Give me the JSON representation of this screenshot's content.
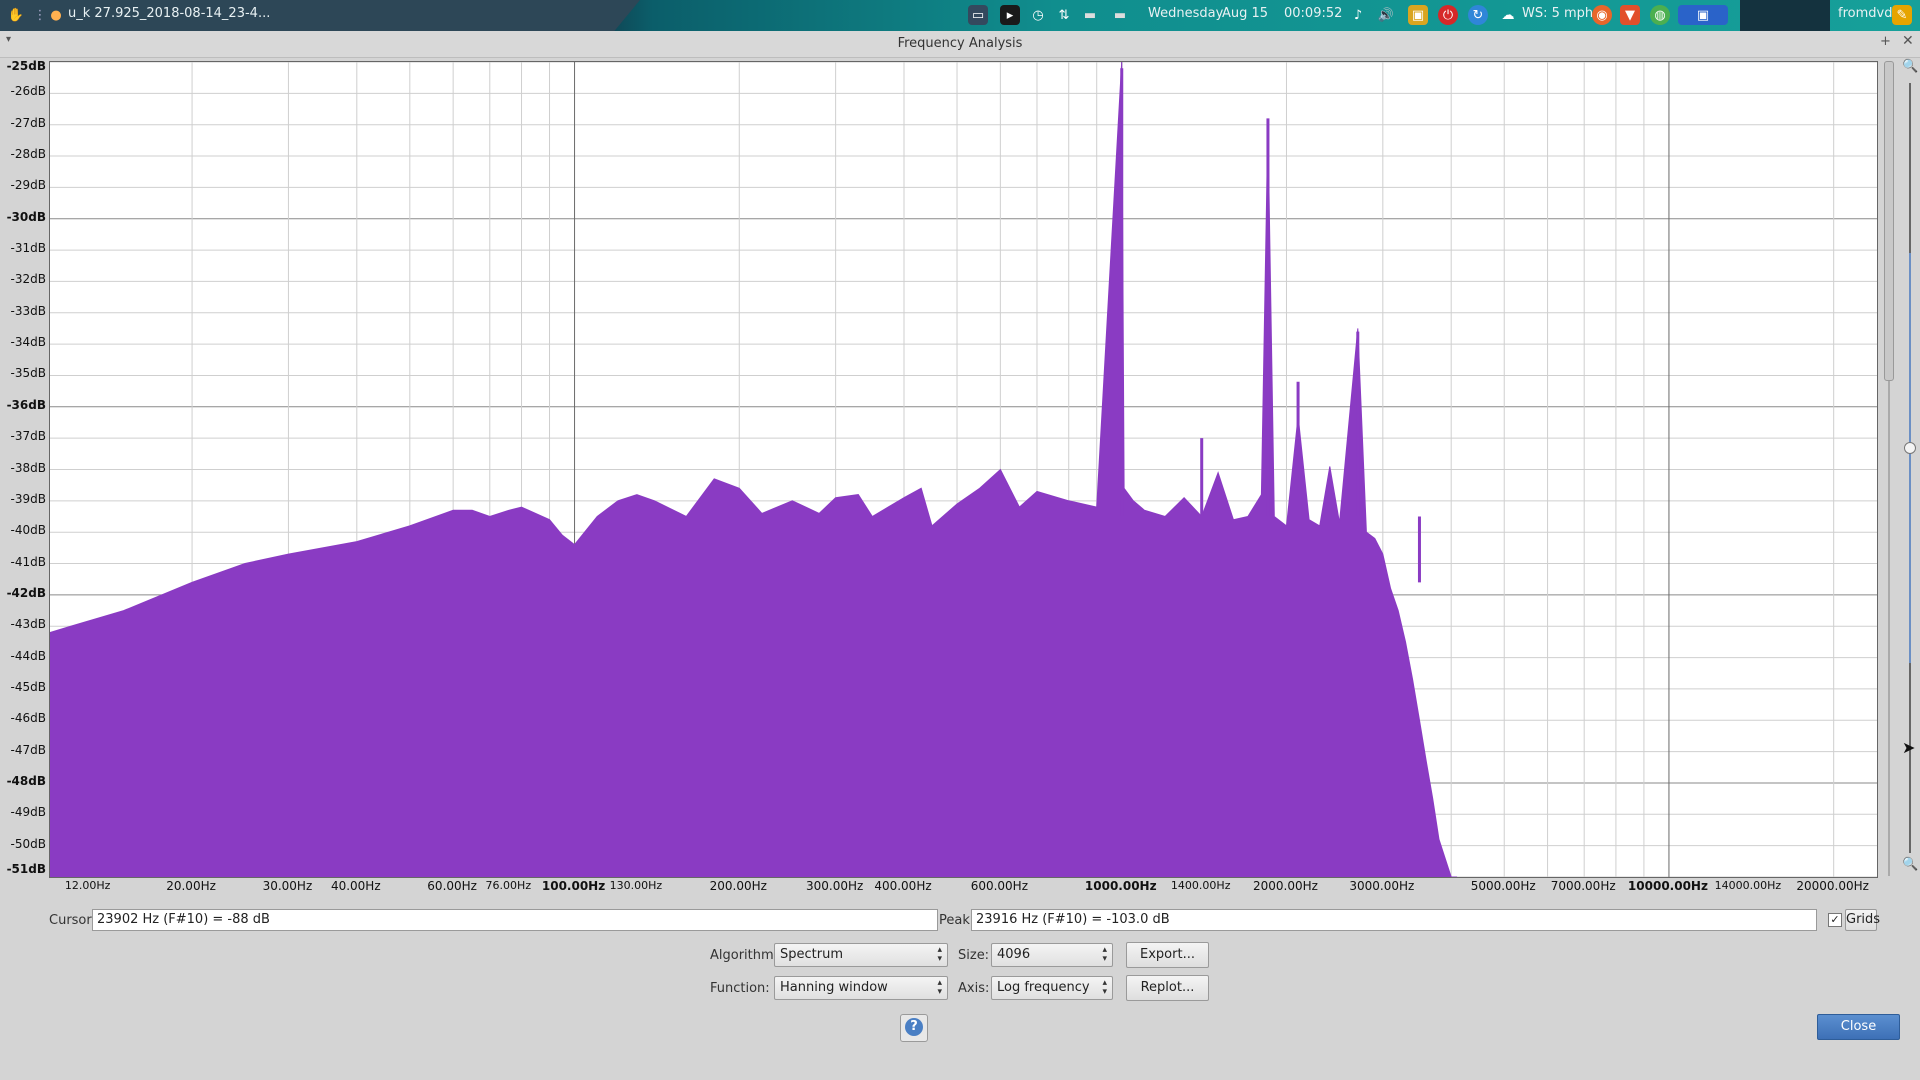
{
  "taskbar": {
    "window_title": "u_k 27.925_2018-08-14_23-4...",
    "day": "Wednesday",
    "date": "Aug 15",
    "time": "00:09:52",
    "weather": "WS: 5 mph",
    "user": "fromdvd"
  },
  "window": {
    "title": "Frequency Analysis"
  },
  "chart_data": {
    "type": "area",
    "title": "",
    "xscale": "log",
    "xlim": [
      11,
      24000
    ],
    "ylim": [
      -51,
      -25
    ],
    "fill_color": "#8a3bc3",
    "grid": true,
    "y_tick_labels": [
      "-25dB",
      "-26dB",
      "-27dB",
      "-28dB",
      "-29dB",
      "-30dB",
      "-31dB",
      "-32dB",
      "-33dB",
      "-34dB",
      "-35dB",
      "-36dB",
      "-37dB",
      "-38dB",
      "-39dB",
      "-40dB",
      "-41dB",
      "-42dB",
      "-43dB",
      "-44dB",
      "-45dB",
      "-46dB",
      "-47dB",
      "-48dB",
      "-49dB",
      "-50dB",
      "-51dB"
    ],
    "x_tick_labels": [
      {
        "f": 12,
        "label": "12.00Hz",
        "size": "small"
      },
      {
        "f": 20,
        "label": "20.00Hz"
      },
      {
        "f": 30,
        "label": "30.00Hz"
      },
      {
        "f": 40,
        "label": "40.00Hz"
      },
      {
        "f": 60,
        "label": "60.00Hz"
      },
      {
        "f": 76,
        "label": "76.00Hz",
        "size": "small"
      },
      {
        "f": 100,
        "label": "100.00Hz",
        "bold": true
      },
      {
        "f": 130,
        "label": "130.00Hz",
        "size": "small"
      },
      {
        "f": 200,
        "label": "200.00Hz"
      },
      {
        "f": 300,
        "label": "300.00Hz"
      },
      {
        "f": 400,
        "label": "400.00Hz"
      },
      {
        "f": 600,
        "label": "600.00Hz"
      },
      {
        "f": 1000,
        "label": "1000.00Hz",
        "bold": true
      },
      {
        "f": 1400,
        "label": "1400.00Hz",
        "size": "small"
      },
      {
        "f": 2000,
        "label": "2000.00Hz"
      },
      {
        "f": 3000,
        "label": "3000.00Hz"
      },
      {
        "f": 5000,
        "label": "5000.00Hz"
      },
      {
        "f": 7000,
        "label": "7000.00Hz"
      },
      {
        "f": 10000,
        "label": "10000.00Hz",
        "bold": true
      },
      {
        "f": 14000,
        "label": "14000.00Hz",
        "size": "small"
      },
      {
        "f": 20000,
        "label": "20000.00Hz"
      }
    ],
    "series": [
      {
        "x": [
          11,
          12,
          15,
          20,
          25,
          30,
          40,
          50,
          60,
          65,
          70,
          76,
          80,
          90,
          95,
          100,
          110,
          120,
          130,
          140,
          160,
          180,
          200,
          220,
          250,
          280,
          300,
          330,
          350,
          400,
          430,
          450,
          500,
          550,
          600,
          650,
          700,
          800,
          900,
          1000,
          1010,
          1050,
          1100,
          1200,
          1300,
          1400,
          1500,
          1600,
          1700,
          1800,
          1850,
          1900,
          2000,
          2100,
          2200,
          2300,
          2400,
          2500,
          2700,
          2800,
          2900,
          3000,
          3100,
          3200,
          3300,
          3400,
          3500,
          3600,
          3700,
          3800,
          4000,
          4100
        ],
        "y": [
          -43.2,
          -43.0,
          -42.5,
          -41.6,
          -41.0,
          -40.7,
          -40.3,
          -39.8,
          -39.3,
          -39.3,
          -39.5,
          -39.3,
          -39.2,
          -39.6,
          -40.1,
          -40.4,
          -39.5,
          -39.0,
          -38.8,
          -39.0,
          -39.5,
          -38.3,
          -38.6,
          -39.4,
          -39.0,
          -39.4,
          -38.9,
          -38.8,
          -39.5,
          -38.9,
          -38.6,
          -39.8,
          -39.1,
          -38.6,
          -38.0,
          -39.2,
          -38.7,
          -39.0,
          -39.2,
          -25.0,
          -38.6,
          -39.0,
          -39.3,
          -39.5,
          -38.9,
          -39.5,
          -38.1,
          -39.6,
          -39.5,
          -38.8,
          -27.0,
          -39.5,
          -39.8,
          -36.3,
          -39.6,
          -39.8,
          -37.9,
          -39.7,
          -33.5,
          -40.0,
          -40.2,
          -40.7,
          -41.8,
          -42.5,
          -43.5,
          -44.7,
          -46.0,
          -47.3,
          -48.5,
          -49.8,
          -51.0,
          -51.0
        ],
        "spikes": [
          {
            "f": 1000,
            "db": -25.2
          },
          {
            "f": 1400,
            "db": -37.0
          },
          {
            "f": 1850,
            "db": -26.8
          },
          {
            "f": 2100,
            "db": -35.2
          },
          {
            "f": 2700,
            "db": -33.6
          },
          {
            "f": 3500,
            "db": -41.6
          }
        ]
      }
    ]
  },
  "controls": {
    "cursor_label": "Cursor:",
    "cursor_value": "23902 Hz (F#10) = -88 dB",
    "peak_label": "Peak:",
    "peak_value": "23916 Hz (F#10) = -103.0 dB",
    "grids_label": "Grids",
    "grids_checked": true,
    "algorithm_label": "Algorithm:",
    "algorithm_value": "Spectrum",
    "size_label": "Size:",
    "size_value": "4096",
    "function_label": "Function:",
    "function_value": "Hanning window",
    "axis_label": "Axis:",
    "axis_value": "Log frequency",
    "export_label": "Export...",
    "replot_label": "Replot...",
    "help_label": "?",
    "close_label": "Close"
  }
}
